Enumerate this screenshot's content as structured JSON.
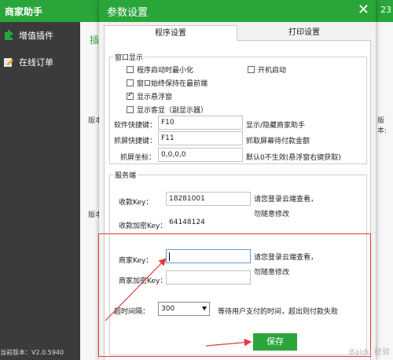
{
  "app": {
    "title": "商家助手",
    "title_right": "23",
    "sidebar": [
      {
        "label": "增值插件"
      },
      {
        "label": "在线订单"
      }
    ],
    "version_label": "当前版本：V2.0.5940",
    "main_tab_partial": "插",
    "bg_version_left_1": "版本",
    "bg_version_left_2": "版本",
    "bg_version_right": "版本:"
  },
  "dialog": {
    "title": "参数设置",
    "close_glyph": "✕",
    "tabs": [
      {
        "label": "程序设置",
        "active": true
      },
      {
        "label": "打印设置",
        "active": false
      }
    ],
    "window_group": {
      "legend": "窗口显示",
      "checkboxes": [
        {
          "label": "程序启动时最小化",
          "checked": false
        },
        {
          "label": "开机启动",
          "checked": false
        },
        {
          "label": "窗口始终保持在最前端",
          "checked": false
        },
        {
          "label": "显示悬浮窗",
          "checked": true
        },
        {
          "label": "显示客显（副显示器）",
          "checked": false
        }
      ],
      "hotkey_label": "软件快捷键：",
      "hotkey_value": "F10",
      "hotkey_desc": "显示/隐藏商家助手",
      "screenshot_label": "抓屏快捷键：",
      "screenshot_value": "F11",
      "screenshot_desc": "抓取屏幕待付款金额",
      "coord_label": "抓屏坐标：",
      "coord_value": "0,0,0,0",
      "coord_desc": "默认0不生效(悬浮窗右键获取)"
    },
    "server_group": {
      "legend": "服务端",
      "collect_key_label": "收款Key：",
      "collect_key_value": "18281001",
      "collect_note_1": "请您登录云端查看，",
      "collect_note_2": "勿随意修改",
      "collect_enc_label": "收款加密Key：",
      "collect_enc_value": "64148124",
      "merchant_key_label": "商家Key：",
      "merchant_key_value": "",
      "merchant_note_1": "请您登录云端查看，",
      "merchant_note_2": "勿随意修改",
      "merchant_enc_label": "商家加密Key：",
      "merchant_enc_value": ""
    },
    "timeout_label": "超时间隔：",
    "timeout_value": "300",
    "timeout_desc": "等待用户支付的时间，超出则付款失败",
    "save_label": "保存"
  },
  "watermark": "Baidu 经验",
  "colors": {
    "brand_green": "#2aa53a",
    "sidebar_dark": "#3b3b3b",
    "annotation_red": "#e23b3b"
  }
}
